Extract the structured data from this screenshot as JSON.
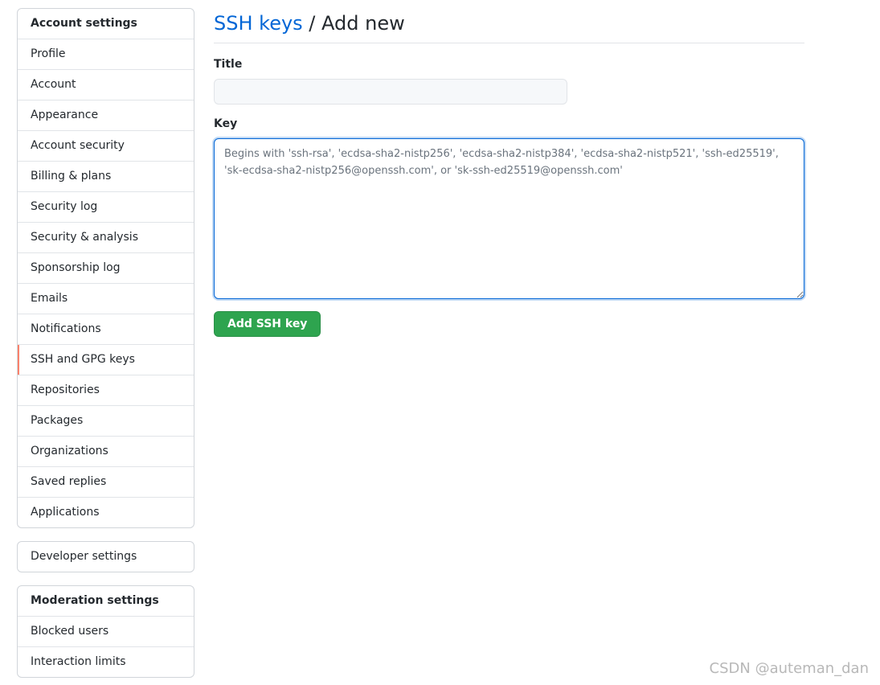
{
  "sidebar": {
    "account": {
      "heading": "Account settings",
      "items": [
        {
          "label": "Profile"
        },
        {
          "label": "Account"
        },
        {
          "label": "Appearance"
        },
        {
          "label": "Account security"
        },
        {
          "label": "Billing & plans"
        },
        {
          "label": "Security log"
        },
        {
          "label": "Security & analysis"
        },
        {
          "label": "Sponsorship log"
        },
        {
          "label": "Emails"
        },
        {
          "label": "Notifications"
        },
        {
          "label": "SSH and GPG keys",
          "selected": true
        },
        {
          "label": "Repositories"
        },
        {
          "label": "Packages"
        },
        {
          "label": "Organizations"
        },
        {
          "label": "Saved replies"
        },
        {
          "label": "Applications"
        }
      ]
    },
    "developer": {
      "label": "Developer settings"
    },
    "moderation": {
      "heading": "Moderation settings",
      "items": [
        {
          "label": "Blocked users"
        },
        {
          "label": "Interaction limits"
        }
      ]
    },
    "selected_color": "#f9826c"
  },
  "main": {
    "breadcrumb_link": "SSH keys",
    "breadcrumb_separator": " / ",
    "breadcrumb_current": "Add new",
    "title_label": "Title",
    "title_value": "",
    "key_label": "Key",
    "key_value": "",
    "key_placeholder": "Begins with 'ssh-rsa', 'ecdsa-sha2-nistp256', 'ecdsa-sha2-nistp384', 'ecdsa-sha2-nistp521', 'ssh-ed25519', 'sk-ecdsa-sha2-nistp256@openssh.com', or 'sk-ssh-ed25519@openssh.com'",
    "submit_label": "Add SSH key"
  },
  "colors": {
    "link": "#0366d6",
    "primary_button": "#2ea44f",
    "focus_border": "#0366d6"
  },
  "watermark": "CSDN @auteman_dan"
}
